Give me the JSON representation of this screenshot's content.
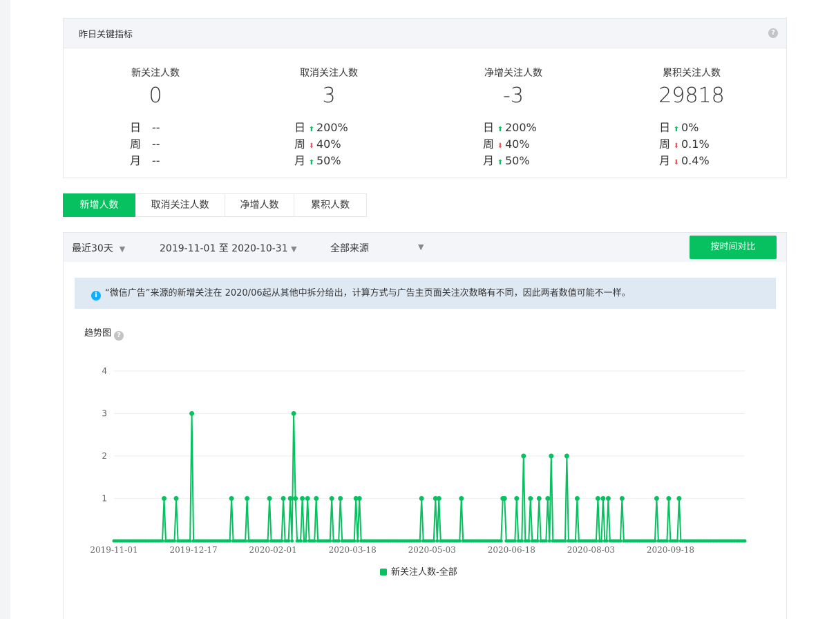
{
  "key_metrics": {
    "title": "昨日关键指标",
    "help_icon": "question-icon",
    "metrics": [
      {
        "title": "新关注人数",
        "value": "0",
        "rows": [
          {
            "label": "日",
            "dir": "none",
            "change": "--"
          },
          {
            "label": "周",
            "dir": "none",
            "change": "--"
          },
          {
            "label": "月",
            "dir": "none",
            "change": "--"
          }
        ]
      },
      {
        "title": "取消关注人数",
        "value": "3",
        "rows": [
          {
            "label": "日",
            "dir": "up",
            "change": "200%"
          },
          {
            "label": "周",
            "dir": "down",
            "change": "40%"
          },
          {
            "label": "月",
            "dir": "up",
            "change": "50%"
          }
        ]
      },
      {
        "title": "净增关注人数",
        "value": "-3",
        "rows": [
          {
            "label": "日",
            "dir": "up",
            "change": "200%"
          },
          {
            "label": "周",
            "dir": "down",
            "change": "40%"
          },
          {
            "label": "月",
            "dir": "up",
            "change": "50%"
          }
        ]
      },
      {
        "title": "累积关注人数",
        "value": "29818",
        "rows": [
          {
            "label": "日",
            "dir": "up",
            "change": "0%"
          },
          {
            "label": "周",
            "dir": "down",
            "change": "0.1%"
          },
          {
            "label": "月",
            "dir": "down",
            "change": "0.4%"
          }
        ]
      }
    ]
  },
  "tabs": [
    "新增人数",
    "取消关注人数",
    "净增人数",
    "累积人数"
  ],
  "active_tab": 0,
  "filters": {
    "period": "最近30天",
    "date_range": "2019-11-01 至 2020-10-31",
    "source": "全部来源",
    "compare_button": "按时间对比"
  },
  "notice": "“微信广告”来源的新增关注在 2020/06起从其他中拆分给出，计算方式与广告主页面关注次数略有不同，因此两者数值可能不一样。",
  "trend_title": "趋势图",
  "colors": {
    "accent": "#07c160",
    "up": "#07c160",
    "down": "#fa5151",
    "info": "#10aeff"
  },
  "chart_data": {
    "type": "line",
    "title": "",
    "xlabel": "",
    "ylabel": "",
    "ylim": [
      0,
      4
    ],
    "yticks": [
      1,
      2,
      3,
      4
    ],
    "x_start": "2019-11-01",
    "x_end": "2020-10-31",
    "xtick_labels": [
      "2019-11-01",
      "2019-12-17",
      "2020-02-01",
      "2020-03-18",
      "2020-05-03",
      "2020-06-18",
      "2020-08-03",
      "2020-09-18"
    ],
    "grid": true,
    "legend_position": "bottom",
    "series": [
      {
        "name": "新关注人数-全部",
        "color": "#07c160",
        "nonzero_points": [
          {
            "x": "2019-11-30",
            "y": 1
          },
          {
            "x": "2019-12-07",
            "y": 1
          },
          {
            "x": "2019-12-16",
            "y": 3
          },
          {
            "x": "2020-01-08",
            "y": 1
          },
          {
            "x": "2020-01-17",
            "y": 1
          },
          {
            "x": "2020-01-30",
            "y": 1
          },
          {
            "x": "2020-02-07",
            "y": 1
          },
          {
            "x": "2020-02-11",
            "y": 1
          },
          {
            "x": "2020-02-13",
            "y": 3
          },
          {
            "x": "2020-02-14",
            "y": 1
          },
          {
            "x": "2020-02-18",
            "y": 1
          },
          {
            "x": "2020-02-21",
            "y": 1
          },
          {
            "x": "2020-02-26",
            "y": 1
          },
          {
            "x": "2020-03-06",
            "y": 1
          },
          {
            "x": "2020-03-11",
            "y": 1
          },
          {
            "x": "2020-03-20",
            "y": 1
          },
          {
            "x": "2020-03-22",
            "y": 1
          },
          {
            "x": "2020-04-27",
            "y": 1
          },
          {
            "x": "2020-05-05",
            "y": 1
          },
          {
            "x": "2020-05-07",
            "y": 1
          },
          {
            "x": "2020-05-20",
            "y": 1
          },
          {
            "x": "2020-06-13",
            "y": 1
          },
          {
            "x": "2020-06-14",
            "y": 1
          },
          {
            "x": "2020-06-21",
            "y": 1
          },
          {
            "x": "2020-06-25",
            "y": 2
          },
          {
            "x": "2020-06-29",
            "y": 1
          },
          {
            "x": "2020-07-04",
            "y": 1
          },
          {
            "x": "2020-07-09",
            "y": 1
          },
          {
            "x": "2020-07-11",
            "y": 2
          },
          {
            "x": "2020-07-20",
            "y": 2
          },
          {
            "x": "2020-07-26",
            "y": 1
          },
          {
            "x": "2020-08-07",
            "y": 1
          },
          {
            "x": "2020-08-10",
            "y": 1
          },
          {
            "x": "2020-08-13",
            "y": 1
          },
          {
            "x": "2020-08-21",
            "y": 1
          },
          {
            "x": "2020-09-10",
            "y": 1
          },
          {
            "x": "2020-09-17",
            "y": 1
          },
          {
            "x": "2020-09-23",
            "y": 1
          }
        ],
        "other_days_value": 0
      }
    ]
  }
}
